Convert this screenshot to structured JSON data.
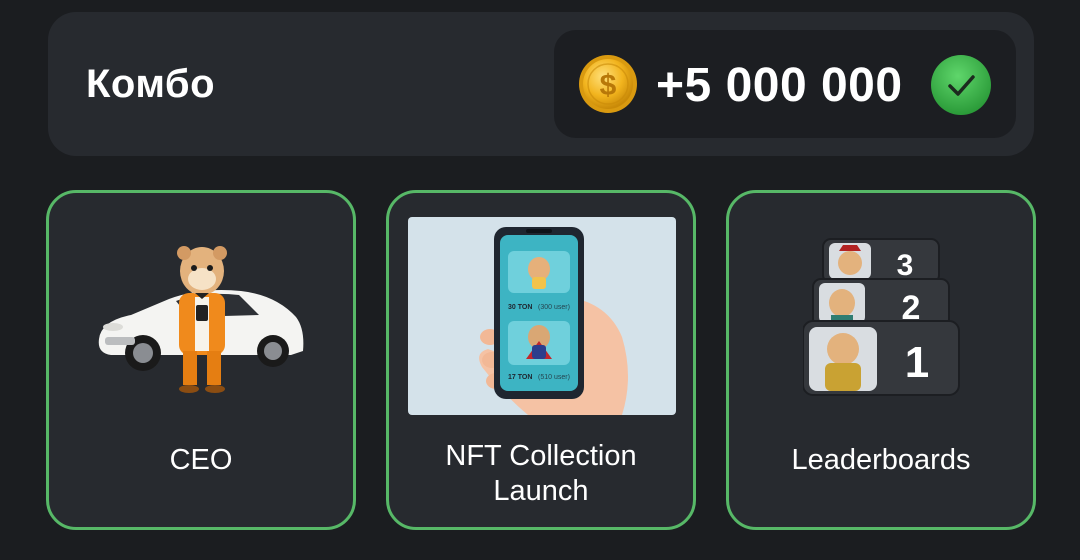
{
  "combo": {
    "title": "Комбо",
    "reward_amount": "+5 000 000",
    "coin_icon": "gold-dollar-coin-icon",
    "status_icon": "green-checkmark-icon",
    "status_color": "#3dab4c"
  },
  "cards": [
    {
      "label": "CEO",
      "image": "hamster-in-orange-suit-with-white-sports-car"
    },
    {
      "label_line1": "NFT Collection",
      "label_line2": "Launch",
      "image": "hand-holding-phone-with-nft-cards",
      "phone_items": [
        {
          "price": "30 TON",
          "note": "(300 user)"
        },
        {
          "price": "17 TON",
          "note": "(510 user)"
        }
      ]
    },
    {
      "label": "Leaderboards",
      "image": "hamster-leaderboard-podium",
      "ranks": [
        "3",
        "2",
        "1"
      ]
    }
  ],
  "colors": {
    "background": "#1b1d20",
    "panel": "#272a2f",
    "reward_box": "#1c1e22",
    "card_border": "#57b867"
  }
}
